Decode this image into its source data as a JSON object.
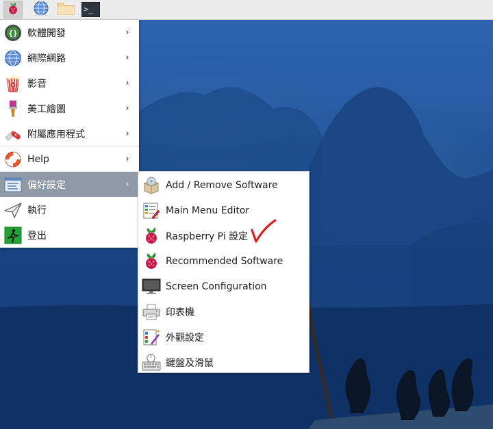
{
  "panel": {
    "buttons": [
      {
        "name": "raspberry-menu-button",
        "icon": "raspberry-icon"
      },
      {
        "name": "web-browser-button",
        "icon": "globe-icon"
      },
      {
        "name": "file-manager-button",
        "icon": "folder-icon"
      },
      {
        "name": "terminal-button",
        "icon": "terminal-icon",
        "text": ">_"
      }
    ]
  },
  "menu": {
    "items": [
      {
        "label": "軟體開發",
        "icon": "programming-icon",
        "has_submenu": true
      },
      {
        "label": "網際網路",
        "icon": "globe-icon",
        "has_submenu": true
      },
      {
        "label": "影音",
        "icon": "popcorn-icon",
        "has_submenu": true
      },
      {
        "label": "美工繪圖",
        "icon": "paintbrush-icon",
        "has_submenu": true
      },
      {
        "label": "附屬應用程式",
        "icon": "swiss-knife-icon",
        "has_submenu": true
      },
      {
        "label": "Help",
        "icon": "lifebuoy-icon",
        "has_submenu": true
      },
      {
        "label": "偏好設定",
        "icon": "preferences-icon",
        "has_submenu": true,
        "selected": true
      },
      {
        "label": "執行",
        "icon": "paper-plane-icon",
        "has_submenu": false
      },
      {
        "label": "登出",
        "icon": "exit-icon",
        "has_submenu": false
      }
    ],
    "arrow": "›"
  },
  "submenu": {
    "items": [
      {
        "label": "Add / Remove Software",
        "icon": "package-icon"
      },
      {
        "label": "Main Menu Editor",
        "icon": "menu-editor-icon"
      },
      {
        "label": "Raspberry Pi 設定",
        "icon": "raspberry-icon"
      },
      {
        "label": "Recommended Software",
        "icon": "raspberry-icon"
      },
      {
        "label": "Screen Configuration",
        "icon": "monitor-icon"
      },
      {
        "label": "印表機",
        "icon": "printer-icon"
      },
      {
        "label": "外觀設定",
        "icon": "appearance-icon"
      },
      {
        "label": "鍵盤及滑鼠",
        "icon": "keyboard-mouse-icon"
      }
    ]
  },
  "colors": {
    "selected_bg": "#8f9aa6",
    "raspberry_red": "#c51a4a",
    "annotation_red": "#d91c1c"
  }
}
